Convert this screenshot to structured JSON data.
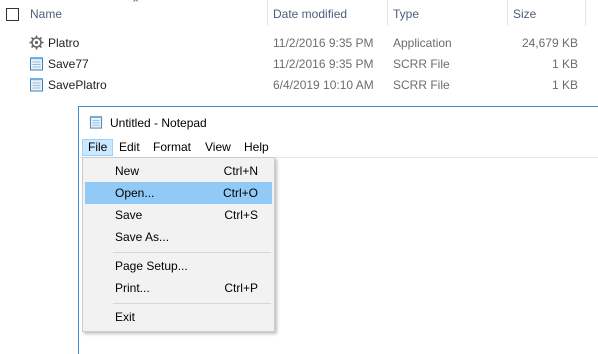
{
  "explorer": {
    "columns": {
      "name": "Name",
      "date": "Date modified",
      "type": "Type",
      "size": "Size"
    },
    "files": [
      {
        "name": "Platro",
        "date": "11/2/2016 9:35 PM",
        "type": "Application",
        "size": "24,679 KB",
        "icon": "application-icon"
      },
      {
        "name": "Save77",
        "date": "11/2/2016 9:35 PM",
        "type": "SCRR File",
        "size": "1 KB",
        "icon": "notepad-file-icon"
      },
      {
        "name": "SavePlatro",
        "date": "6/4/2019 10:10 AM",
        "type": "SCRR File",
        "size": "1 KB",
        "icon": "notepad-file-icon"
      }
    ]
  },
  "notepad": {
    "title": "Untitled - Notepad",
    "menu": [
      "File",
      "Edit",
      "Format",
      "View",
      "Help"
    ],
    "file_menu": [
      {
        "label": "New",
        "shortcut": "Ctrl+N"
      },
      {
        "label": "Open...",
        "shortcut": "Ctrl+O"
      },
      {
        "label": "Save",
        "shortcut": "Ctrl+S"
      },
      {
        "label": "Save As...",
        "shortcut": ""
      },
      {
        "label": "Page Setup...",
        "shortcut": ""
      },
      {
        "label": "Print...",
        "shortcut": "Ctrl+P"
      },
      {
        "label": "Exit",
        "shortcut": ""
      }
    ]
  },
  "colors": {
    "highlight": "#91c9f7",
    "window_border": "#3c8ed4",
    "header_text": "#4c607a"
  }
}
